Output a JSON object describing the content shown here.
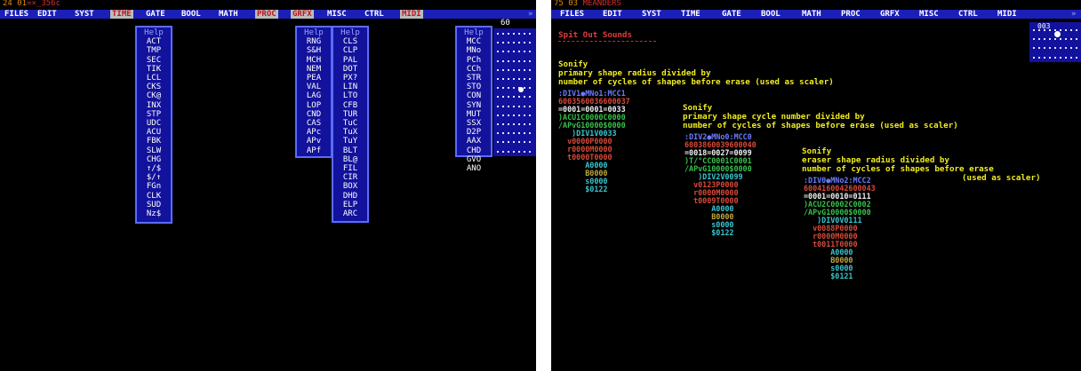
{
  "left": {
    "status": {
      "prefix": "24 01",
      "rest": "=×_356c"
    },
    "menubar": [
      "FILES",
      "EDIT",
      "SYST",
      "TIME",
      "GATE",
      "BOOL",
      "MATH",
      "PROC",
      "GRFX",
      "MISC",
      "CTRL",
      "MIDI"
    ],
    "selected_menus": [
      "TIME",
      "PROC",
      "GRFX",
      "MIDI"
    ],
    "time_menu": [
      "Help",
      "ACT",
      "TMP",
      "SEC",
      "TIK",
      "LCL",
      "CKS",
      "CK@",
      "INX",
      "STP",
      "UDC",
      "ACU",
      "FBK",
      "SLW",
      "CHG",
      "↑/$",
      "$/↑",
      "FGn",
      "CLK",
      "SUD",
      "Nz$"
    ],
    "proc_menu": [
      "Help",
      "RNG",
      "S&H",
      "MCH",
      "NEM",
      "PEA",
      "VAL",
      "LAG",
      "LOP",
      "CND",
      "CAS",
      "APc",
      "APv",
      "APf"
    ],
    "grfx_menu": [
      "Help",
      "CLS",
      "CLP",
      "PAL",
      "DOT",
      "PX?",
      "LIN",
      "LTO",
      "CFB",
      "TUR",
      "TuC",
      "TuX",
      "TuY",
      "BLT",
      "BL@",
      "FIL",
      "CIR",
      "BOX",
      "DHD",
      "ELP",
      "ARC"
    ],
    "midi_menu": [
      "Help",
      "MCC",
      "MNo",
      "PCh",
      "CCh",
      "STR",
      "STO",
      "CON",
      "SYN",
      "MUT",
      "SSX",
      "D2P",
      "AAX",
      "CHD",
      "GVO",
      "ANO"
    ],
    "panel_value": "60"
  },
  "right": {
    "status": {
      "prefix": "75 03",
      "rest": "MEANDERS"
    },
    "menubar": [
      "FILES",
      "EDIT",
      "SYST",
      "TIME",
      "GATE",
      "BOOL",
      "MATH",
      "PROC",
      "GRFX",
      "MISC",
      "CTRL",
      "MIDI"
    ],
    "panel_value": "003",
    "title": "Spit Out Sounds",
    "sections": [
      {
        "heading": "Sonify",
        "line1": "primary shape radius divided by",
        "line2": "number of cycles of shapes before erase (used as scaler)"
      },
      {
        "heading": "Sonify",
        "line1": "primary shape cycle number divided by",
        "line2": "number of cycles of shapes before erase (used as scaler)"
      },
      {
        "heading": "Sonify",
        "line1": "eraser shape radius divided by",
        "line2": "number of cycles of shapes before erase",
        "line3": "(used as scaler)"
      }
    ],
    "block1": [
      ":DIV1●MNo1:MCC1",
      "6003560036600037",
      "=0001=0001=0033",
      ")ACU1C0000C0000",
      "/APvG10000$0000",
      "   )DIV1V0033",
      "  v0000P0000",
      "  r0000M0000",
      "  t0000T0000",
      "      A0000",
      "      B0000",
      "      s0000",
      "      $0122"
    ],
    "block2": [
      ":DIV2●MNo0:MCC0",
      "6003860039600040",
      "=0018=0027=0099",
      ")T/°CC0001C0001",
      "/APvG10000$0000",
      "   )DIV2V0099",
      "  v0123P0000",
      "  r0000M0000",
      "  t0009T0000",
      "      A0000",
      "      B0000",
      "      s0000",
      "      $0122"
    ],
    "block3": [
      ":DIV0●MNo2:MCC2",
      "6004160042600043",
      "=0001=0010=0111",
      ")ACU2C0002C0002",
      "/APvG10000$0000",
      "   )DIV0V0111",
      "  v0088P0000",
      "  r0000M0000",
      "  t0011T0000",
      "      A0000",
      "      B0000",
      "      s0000",
      "      $0121"
    ]
  }
}
